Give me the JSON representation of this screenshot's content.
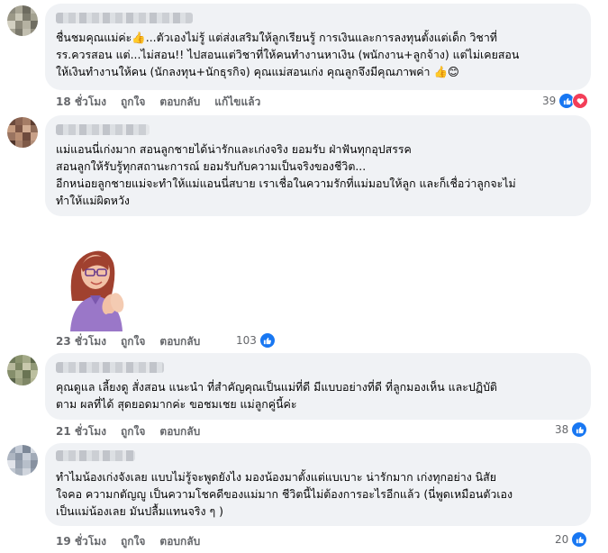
{
  "comments": [
    {
      "text": "ชื่นชมคุณแม่ค่ะ👍...ตัวเองไม่รู้ แต่ส่งเสริมให้ลูกเรียนรู้ การเงินและการลงทุนตั้งแต่เด็ก วิชาที่\nรร.ควรสอน แต่...ไม่สอน!! ไปสอนแต่วิชาที่ให้คนทำงานหาเงิน (พนักงาน+ลูกจ้าง) แต่ไม่เคยสอน\nให้เงินทำงานให้คน (นักลงทุน+นักธุรกิจ) คุณแม่สอนเก่ง คุณลูกจึงมีคุณภาพค่า 👍😊",
      "time": "18 ชั่วโมง",
      "like": "ถูกใจ",
      "reply": "ตอบกลับ",
      "edited": "แก้ไขแล้ว",
      "reactions": "39"
    },
    {
      "text": "แม่แอนนี่เก่งมาก สอนลูกชายได้น่ารักและเก่งจริง ยอมรับ ฝ่าฟันทุกอุปสรรค\nสอนลูกให้รับรู้ทุกสถานะการณ์ ยอมรับกับความเป็นจริงของชีวิต...\nอีกหน่อยลูกชายแม่จะทำให้แม่แอนนี่สบาย เราเชื่อในความรักที่แม่มอบให้ลูก และก็เชื่อว่าลูกจะไม่\nทำให้แม่ผิดหวัง",
      "time": "23 ชั่วโมง",
      "like": "ถูกใจ",
      "reply": "ตอบกลับ",
      "reactions": "103"
    },
    {
      "text": "คุณดูแล เลี้ยงดู สั่งสอน แนะนำ ที่สำคัญคุณเป็นแม่ที่ดี มีแบบอย่างที่ดี ที่ลูกมองเห็น และปฏิบัติ\nตาม ผลที่ได้ สุดยอดมากค่ะ ขอชมเชย แม่ลูกคู่นี้ค่ะ",
      "time": "21 ชั่วโมง",
      "like": "ถูกใจ",
      "reply": "ตอบกลับ",
      "reactions": "38"
    },
    {
      "text": "ทำไมน้องเก่งจังเลย แบบไม่รู้จะพูดยังไง มองน้องมาตั้งแต่แบเบาะ น่ารักมาก เก่งทุกอย่าง นิสัย\nใจคอ ความกตัญญู เป็นความโชคดีของแม่มาก ชีวิตนี้ไม่ต้องการอะไรอีกแล้ว (นี่พูดเหมือนตัวเอง\nเป็นแม่น้องเลย มันปลื้มแทนจริง ๆ )",
      "time": "19 ชั่วโมง",
      "like": "ถูกใจ",
      "reply": "ตอบกลับ",
      "reactions": "20"
    }
  ],
  "colors": {
    "bubble": "#f0f2f5",
    "muted": "#65676b",
    "like": "#1877f2",
    "love": "#f33e58"
  },
  "icons": [
    "like-icon",
    "love-icon",
    "thumbs-up-emoji",
    "smile-emoji",
    "avatar-sticker"
  ]
}
